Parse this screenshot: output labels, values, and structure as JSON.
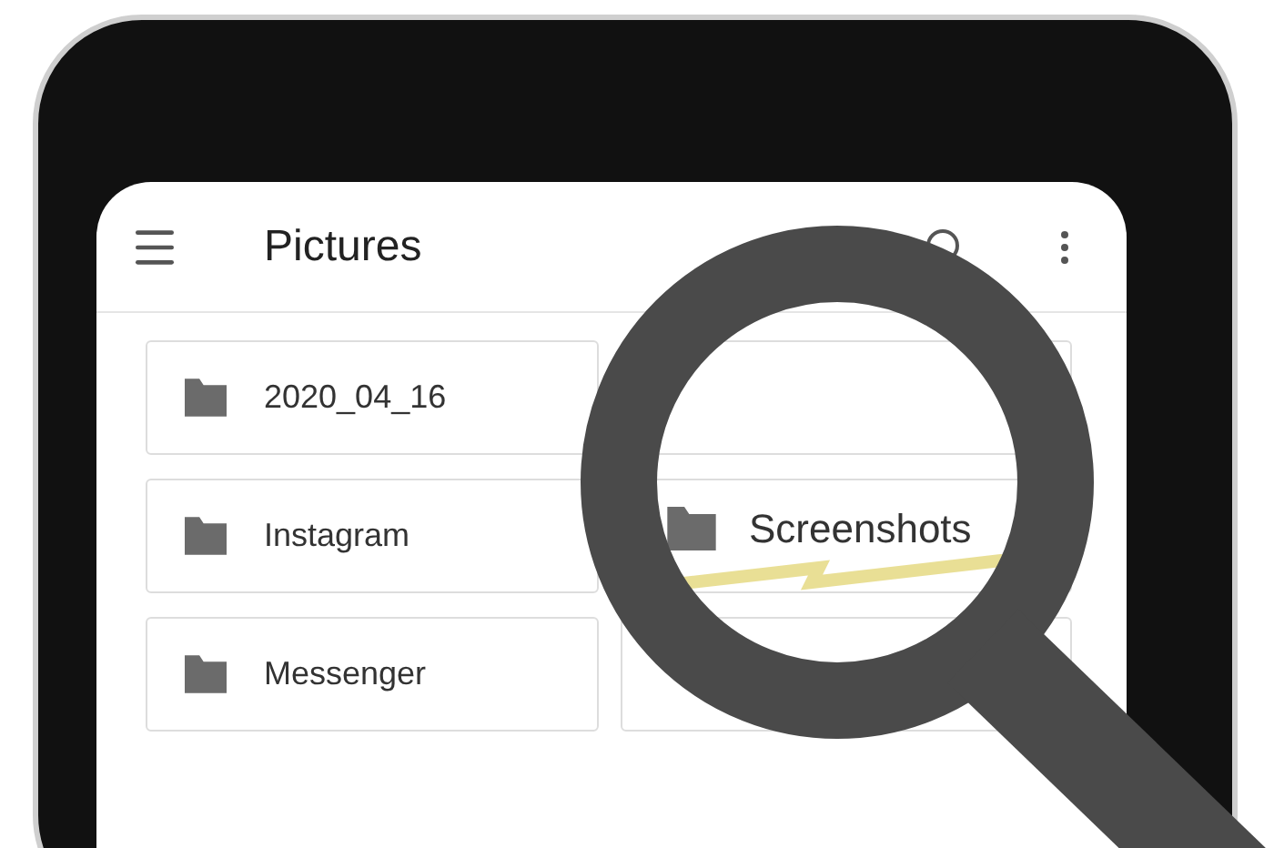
{
  "app_bar": {
    "title": "Pictures"
  },
  "folders": [
    {
      "name": "2020_04_16"
    },
    {
      "name": "Instagram"
    },
    {
      "name": "Messenger"
    }
  ],
  "magnified_folder": {
    "name": "Screenshots"
  }
}
